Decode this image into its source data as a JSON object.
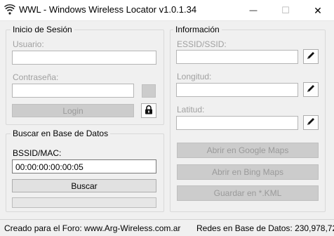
{
  "window": {
    "title": "WWL - Windows Wireless Locator v1.0.1.34",
    "minimize_glyph": "—",
    "maximize_glyph": "☐",
    "close_glyph": "✕"
  },
  "login": {
    "legend": "Inicio de Sesión",
    "user_label": "Usuario:",
    "user_value": "",
    "password_label": "Contraseña:",
    "password_value": "",
    "login_button": "Login",
    "lock_icon": "lock-icon"
  },
  "search": {
    "legend": "Buscar en Base de Datos",
    "bssid_label": "BSSID/MAC:",
    "bssid_value": "00:00:00:00:00:05",
    "search_button": "Buscar",
    "progress_percent": 0
  },
  "info": {
    "legend": "Información",
    "essid_label": "ESSID/SSID:",
    "essid_value": "",
    "longitude_label": "Longitud:",
    "longitude_value": "",
    "latitude_label": "Latitud:",
    "latitude_value": "",
    "edit_icon": "pencil-icon",
    "google_button": "Abrir en Google Maps",
    "bing_button": "Abrir en Bing Maps",
    "kml_button": "Guardar en *.KML"
  },
  "status": {
    "left": "Creado para el Foro: www.Arg-Wireless.com.ar",
    "right": "Redes en Base de Datos: 230,978,727"
  },
  "colors": {
    "window_bg": "#f0f0f0",
    "disabled_text": "#a0a0a0",
    "disabled_button": "#cccccc"
  }
}
